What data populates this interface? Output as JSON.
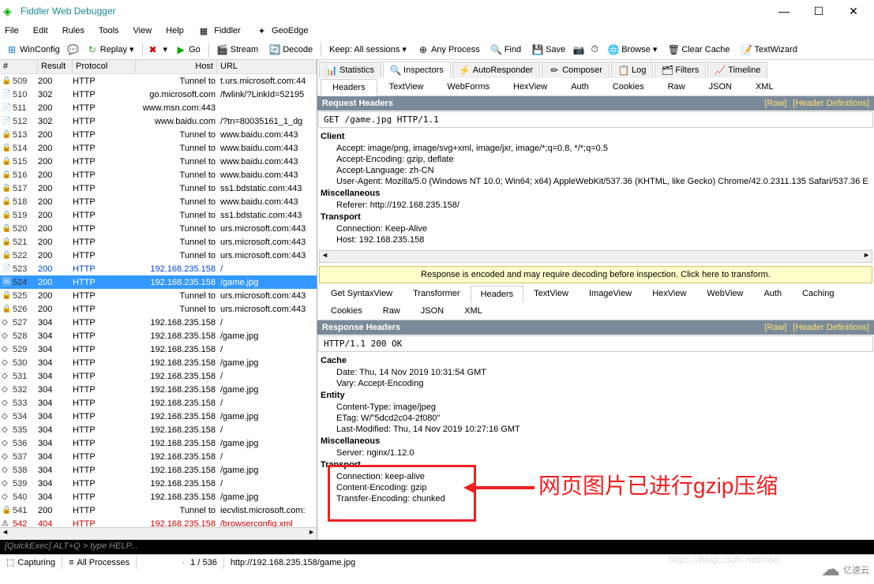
{
  "window": {
    "title": "Fiddler Web Debugger"
  },
  "menu": [
    "File",
    "Edit",
    "Rules",
    "Tools",
    "View",
    "Help"
  ],
  "menu_extra": [
    "Fiddler",
    "GeoEdge"
  ],
  "toolbar": {
    "winconfig": "WinConfig",
    "replay": "Replay",
    "go": "Go",
    "stream": "Stream",
    "decode": "Decode",
    "keep": "Keep: All sessions",
    "anyproc": "Any Process",
    "find": "Find",
    "save": "Save",
    "browse": "Browse",
    "clearcache": "Clear Cache",
    "textwizard": "TextWizard"
  },
  "grid": {
    "headers": {
      "num": "#",
      "result": "Result",
      "protocol": "Protocol",
      "host": "Host",
      "url": "URL"
    },
    "rows": [
      {
        "ic": "lock",
        "n": "509",
        "r": "200",
        "p": "HTTP",
        "h": "Tunnel to",
        "u": "t.urs.microsoft.com:44"
      },
      {
        "ic": "doc",
        "n": "510",
        "r": "302",
        "p": "HTTP",
        "h": "go.microsoft.com",
        "u": "/fwlink/?LinkId=52195"
      },
      {
        "ic": "doc",
        "n": "511",
        "r": "200",
        "p": "HTTP",
        "h": "www.msn.com:443",
        "u": ""
      },
      {
        "ic": "doc",
        "n": "512",
        "r": "302",
        "p": "HTTP",
        "h": "www.baidu.com",
        "u": "/?tn=80035161_1_dg"
      },
      {
        "ic": "lock",
        "n": "513",
        "r": "200",
        "p": "HTTP",
        "h": "Tunnel to",
        "u": "www.baidu.com:443"
      },
      {
        "ic": "lock",
        "n": "514",
        "r": "200",
        "p": "HTTP",
        "h": "Tunnel to",
        "u": "www.baidu.com:443"
      },
      {
        "ic": "lock",
        "n": "515",
        "r": "200",
        "p": "HTTP",
        "h": "Tunnel to",
        "u": "www.baidu.com:443"
      },
      {
        "ic": "lock",
        "n": "516",
        "r": "200",
        "p": "HTTP",
        "h": "Tunnel to",
        "u": "www.baidu.com:443"
      },
      {
        "ic": "lock",
        "n": "517",
        "r": "200",
        "p": "HTTP",
        "h": "Tunnel to",
        "u": "ss1.bdstatic.com:443"
      },
      {
        "ic": "lock",
        "n": "518",
        "r": "200",
        "p": "HTTP",
        "h": "Tunnel to",
        "u": "www.baidu.com:443"
      },
      {
        "ic": "lock",
        "n": "519",
        "r": "200",
        "p": "HTTP",
        "h": "Tunnel to",
        "u": "ss1.bdstatic.com:443"
      },
      {
        "ic": "lock",
        "n": "520",
        "r": "200",
        "p": "HTTP",
        "h": "Tunnel to",
        "u": "urs.microsoft.com:443"
      },
      {
        "ic": "lock",
        "n": "521",
        "r": "200",
        "p": "HTTP",
        "h": "Tunnel to",
        "u": "urs.microsoft.com:443"
      },
      {
        "ic": "lock",
        "n": "522",
        "r": "200",
        "p": "HTTP",
        "h": "Tunnel to",
        "u": "urs.microsoft.com:443"
      },
      {
        "ic": "doc",
        "n": "523",
        "r": "200",
        "p": "HTTP",
        "h": "192.168.235.158",
        "u": "/",
        "cls": "blue"
      },
      {
        "ic": "img",
        "n": "524",
        "r": "200",
        "p": "HTTP",
        "h": "192.168.235.158",
        "u": "/game.jpg",
        "cls": "sel"
      },
      {
        "ic": "lock",
        "n": "525",
        "r": "200",
        "p": "HTTP",
        "h": "Tunnel to",
        "u": "urs.microsoft.com:443"
      },
      {
        "ic": "lock",
        "n": "526",
        "r": "200",
        "p": "HTTP",
        "h": "Tunnel to",
        "u": "urs.microsoft.com:443"
      },
      {
        "ic": "diam",
        "n": "527",
        "r": "304",
        "p": "HTTP",
        "h": "192.168.235.158",
        "u": "/"
      },
      {
        "ic": "diam",
        "n": "528",
        "r": "304",
        "p": "HTTP",
        "h": "192.168.235.158",
        "u": "/game.jpg"
      },
      {
        "ic": "diam",
        "n": "529",
        "r": "304",
        "p": "HTTP",
        "h": "192.168.235.158",
        "u": "/"
      },
      {
        "ic": "diam",
        "n": "530",
        "r": "304",
        "p": "HTTP",
        "h": "192.168.235.158",
        "u": "/game.jpg"
      },
      {
        "ic": "diam",
        "n": "531",
        "r": "304",
        "p": "HTTP",
        "h": "192.168.235.158",
        "u": "/"
      },
      {
        "ic": "diam",
        "n": "532",
        "r": "304",
        "p": "HTTP",
        "h": "192.168.235.158",
        "u": "/game.jpg"
      },
      {
        "ic": "diam",
        "n": "533",
        "r": "304",
        "p": "HTTP",
        "h": "192.168.235.158",
        "u": "/"
      },
      {
        "ic": "diam",
        "n": "534",
        "r": "304",
        "p": "HTTP",
        "h": "192.168.235.158",
        "u": "/game.jpg"
      },
      {
        "ic": "diam",
        "n": "535",
        "r": "304",
        "p": "HTTP",
        "h": "192.168.235.158",
        "u": "/"
      },
      {
        "ic": "diam",
        "n": "536",
        "r": "304",
        "p": "HTTP",
        "h": "192.168.235.158",
        "u": "/game.jpg"
      },
      {
        "ic": "diam",
        "n": "537",
        "r": "304",
        "p": "HTTP",
        "h": "192.168.235.158",
        "u": "/"
      },
      {
        "ic": "diam",
        "n": "538",
        "r": "304",
        "p": "HTTP",
        "h": "192.168.235.158",
        "u": "/game.jpg"
      },
      {
        "ic": "diam",
        "n": "539",
        "r": "304",
        "p": "HTTP",
        "h": "192.168.235.158",
        "u": "/"
      },
      {
        "ic": "diam",
        "n": "540",
        "r": "304",
        "p": "HTTP",
        "h": "192.168.235.158",
        "u": "/game.jpg"
      },
      {
        "ic": "lock",
        "n": "541",
        "r": "200",
        "p": "HTTP",
        "h": "Tunnel to",
        "u": "iecvlist.microsoft.com:"
      },
      {
        "ic": "warn",
        "n": "542",
        "r": "404",
        "p": "HTTP",
        "h": "192.168.235.158",
        "u": "/browserconfig.xml",
        "cls": "red"
      }
    ]
  },
  "inspector_tabs": [
    "Statistics",
    "Inspectors",
    "AutoResponder",
    "Composer",
    "Log",
    "Filters",
    "Timeline"
  ],
  "inspector_active": 1,
  "req_tabs": [
    "Headers",
    "TextView",
    "WebForms",
    "HexView",
    "Auth",
    "Cookies",
    "Raw",
    "JSON",
    "XML"
  ],
  "req_tab_active": 0,
  "request": {
    "title": "Request Headers",
    "raw": "[Raw]",
    "defs": "[Header Definitions]",
    "line": "GET /game.jpg HTTP/1.1",
    "groups": [
      {
        "name": "Client",
        "items": [
          "Accept: image/png, image/svg+xml, image/jxr, image/*;q=0.8, */*;q=0.5",
          "Accept-Encoding: gzip, deflate",
          "Accept-Language: zh-CN",
          "User-Agent: Mozilla/5.0 (Windows NT 10.0; Win64; x64) AppleWebKit/537.36 (KHTML, like Gecko) Chrome/42.0.2311.135 Safari/537.36 E"
        ]
      },
      {
        "name": "Miscellaneous",
        "items": [
          "Referer: http://192.168.235.158/"
        ]
      },
      {
        "name": "Transport",
        "items": [
          "Connection: Keep-Alive",
          "Host: 192.168.235.158"
        ]
      }
    ]
  },
  "decode_msg": "Response is encoded and may require decoding before inspection. Click here to transform.",
  "resp_tabs_row1": [
    "Get SyntaxView",
    "Transformer",
    "Headers",
    "TextView",
    "ImageView",
    "HexView",
    "WebView",
    "Auth",
    "Caching",
    "Cookies"
  ],
  "resp_tabs_row2": [
    "Raw",
    "JSON",
    "XML"
  ],
  "resp_tab_active": "Headers",
  "response": {
    "title": "Response Headers",
    "raw": "[Raw]",
    "defs": "[Header Definitions]",
    "line": "HTTP/1.1 200 OK",
    "groups": [
      {
        "name": "Cache",
        "items": [
          "Date: Thu, 14 Nov 2019 10:31:54 GMT",
          "Vary: Accept-Encoding"
        ]
      },
      {
        "name": "Entity",
        "items": [
          "Content-Type: image/jpeg",
          "ETag: W/\"5dcd2c04-2f080\"",
          "Last-Modified: Thu, 14 Nov 2019 10:27:16 GMT"
        ]
      },
      {
        "name": "Miscellaneous",
        "items": [
          "Server: nginx/1.12.0"
        ]
      },
      {
        "name": "Transport",
        "items": [
          "Connection: keep-alive",
          "Content-Encoding: gzip",
          "Transfer-Encoding: chunked"
        ]
      }
    ]
  },
  "annotation": "网页图片已进行gzip压缩",
  "quickexec": "[QuickExec] ALT+Q > type HELP...",
  "status": {
    "capturing": "Capturing",
    "processes": "All Processes",
    "count": "1 / 536",
    "url": "http://192.168.235.158/game.jpg"
  },
  "watermark": "https://blog.csdn.net/cao",
  "brand": "亿速云"
}
